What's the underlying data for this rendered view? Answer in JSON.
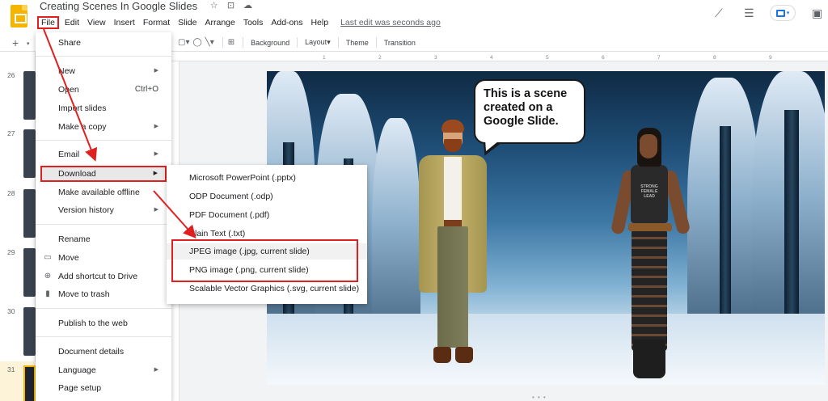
{
  "app": {
    "doc_title": "Creating Scenes In Google Slides",
    "last_edit": "Last edit was seconds ago"
  },
  "menubar": {
    "items": [
      "File",
      "Edit",
      "View",
      "Insert",
      "Format",
      "Slide",
      "Arrange",
      "Tools",
      "Add-ons",
      "Help"
    ]
  },
  "toolbar": {
    "background": "Background",
    "layout": "Layout",
    "theme": "Theme",
    "transition": "Transition"
  },
  "ruler": {
    "ticks": [
      "1",
      "2",
      "3",
      "4",
      "5",
      "6",
      "7",
      "8",
      "9"
    ]
  },
  "filmstrip": {
    "slides": [
      "26",
      "27",
      "28",
      "29",
      "30",
      "31"
    ],
    "selected": "31"
  },
  "file_menu": {
    "share": "Share",
    "new": "New",
    "open": "Open",
    "open_shortcut": "Ctrl+O",
    "import_slides": "Import slides",
    "make_a_copy": "Make a copy",
    "email": "Email",
    "download": "Download",
    "make_available_offline": "Make available offline",
    "version_history": "Version history",
    "rename": "Rename",
    "move": "Move",
    "add_shortcut": "Add shortcut to Drive",
    "move_to_trash": "Move to trash",
    "publish": "Publish to the web",
    "document_details": "Document details",
    "language": "Language",
    "page_setup": "Page setup"
  },
  "download_menu": {
    "items": [
      "Microsoft PowerPoint (.pptx)",
      "ODP Document (.odp)",
      "PDF Document (.pdf)",
      "Plain Text (.txt)",
      "JPEG image (.jpg, current slide)",
      "PNG image (.png, current slide)",
      "Scalable Vector Graphics (.svg, current slide)"
    ]
  },
  "slide": {
    "speech_bubble": "This is a scene created on a Google Slide.",
    "shirt_text": "STRONG FEMALE LEAD"
  },
  "colors": {
    "accent_blue": "#1a73e8",
    "annotation_red": "#e02020",
    "slides_yellow": "#f4b400"
  },
  "icons": {
    "star": "star-icon",
    "folder": "move-to-folder-icon",
    "cloud": "cloud-saved-icon",
    "activity": "activity-trend-icon",
    "comments": "comments-icon",
    "present": "present-icon",
    "slideshow": "slideshow-icon"
  }
}
